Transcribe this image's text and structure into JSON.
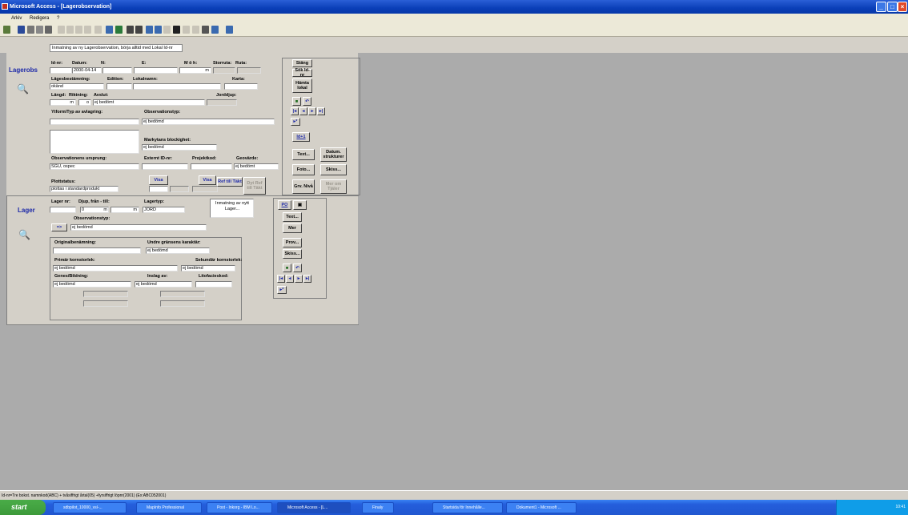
{
  "app": {
    "title": "Microsoft Access - [Lagerobservation]"
  },
  "menu": {
    "items": [
      "Arkiv",
      "Redigera",
      "?"
    ]
  },
  "form": {
    "hint": "Inmatning av ny Lagerobservation, börja alltid med Lokal Id-nr"
  },
  "lagerobs": {
    "title": "Lagerobs",
    "labels": {
      "idnr": "Id-nr:",
      "datum": "Datum:",
      "n": "N:",
      "e": "E:",
      "moh": "M ö h:",
      "storrute": "Storruta:",
      "ruta": "Ruta:",
      "lagesbestamning": "Lägesbestämning:",
      "edition": "Edition:",
      "lokalnamn": "Lokalnamn:",
      "karta": "Karta:",
      "langd": "Längd:",
      "riktning": "Riktning:",
      "avslut": "Avslut:",
      "jorddjup": "Jorddjup:",
      "ytform": "Ytform/Typ av avlagring:",
      "observationstyp": "Observationstyp:",
      "markytans": "Markytans blockighet:",
      "ursprung": "Observationens ursprung:",
      "externt": "Externt ID-nr:",
      "projektkod": "Projektkod:",
      "geovarde": "Geovärde:",
      "plottstatus": "Plottstatus:"
    },
    "values": {
      "datum": "2000-04-14",
      "moh": "m",
      "lagesbestamning": "okänd",
      "langd": "m",
      "riktning": "o",
      "avslut": "ej bedömt",
      "observationstyp": "ej bedömd",
      "markytans": "ej bedömd",
      "ursprung": "SGU, ospec",
      "geovarde": "ej bedömt",
      "plottstatus": "plottas i standardprodukt"
    },
    "buttons": {
      "stang": "Stäng",
      "sokidnr": "Sök Id-nr",
      "hamta_lokal": "Hämta lokal",
      "idplus1": "Id+1",
      "text": "Text...",
      "datum_strukturer": "Datum. strukturer",
      "foto": "Foto...",
      "skiss": "Skiss...",
      "grv_niva": "Grv. Nivå",
      "mer_om_tjaler": "Mer om Tjäler",
      "visa1": "Visa",
      "visa2": "Visa",
      "ref_till_takt": "Ref till Täkt",
      "dyt_ref": "Dyt Ref till Täkt"
    }
  },
  "lager": {
    "title": "Lager",
    "note": "Inmatning av nytt Lager...",
    "labels": {
      "lagernr": "Lager nr:",
      "djup": "Djup, från - till:",
      "lagertyp": "Lagertyp:",
      "observationstyp": "Observationstyp:",
      "originalbenamning": "Originalbenämning:",
      "undre_grans": "Undre gränsens karaktär:",
      "primar": "Primär kornstorlek:",
      "sekundar": "Sekundär kornstorlek:",
      "genes": "Genes/Bildning:",
      "inslag": "Inslag av:",
      "litofacies": "Litofacieskod:"
    },
    "values": {
      "djup_fran": "0",
      "djup_fran_unit": "m",
      "djup_till_unit": "m",
      "lagertyp": "JORD",
      "observationstyp": "ej bedömd",
      "undre_grans": "ej bedömd",
      "primar": "ej bedömd",
      "sekundar": "ej bedömd",
      "genes": "ej bedömd",
      "inslag": "ej bedömd"
    },
    "buttons": {
      "arrow": "=>",
      "po": "PO",
      "text": "Text...",
      "mer": "Mer",
      "prov": "Prov...",
      "skiss": "Skiss..."
    }
  },
  "status": {
    "text": "Id-nr=Tre bokst. namnkod(ABC) + tvåsiffrigt årtal(05) +fyrsiffrigt löpnr(2001) (Ex:ABC052001)"
  },
  "taskbar": {
    "start": "start",
    "tasks": [
      "sdbpilot_10000_vsl-...",
      "MapInfo Professional",
      "Post - Inkorg - IBM Lo...",
      "Microsoft Access - [L...",
      "Finaly",
      "Startsida för Innehålle...",
      "Dokument1 - Microsoft ..."
    ],
    "clock": "10:41"
  }
}
